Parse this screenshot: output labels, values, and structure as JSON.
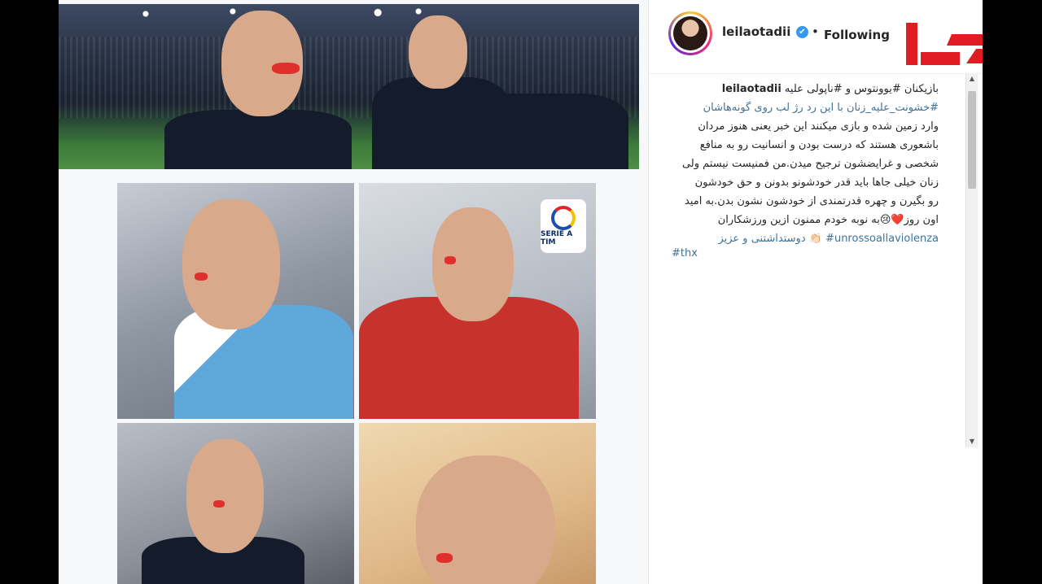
{
  "profile": {
    "username": "leilaotadii",
    "verified_symbol": "✔",
    "separator": "•",
    "follow_status": "Following"
  },
  "caption": {
    "owner": "leilaotadii",
    "text_lines": [
      "بازیکنان #یوونتوس و #ناپولی علیه",
      "#خشونت_علیه_زنان با این رد رژ لب روی گونه‌هاشان",
      "وارد زمین شده و بازی میکنند این خبر یعنی هنوز مردان",
      "باشعوری هستند که درست بودن و انسانیت رو به منافع",
      "شخصی و غرایضشون ترجیح میدن.من فمنیست نیستم ولی",
      "زنان خیلی جاها باید قدر خودشونو بدونن و حق خودشون",
      "رو بگیرن و چهره قدرتمندی از خودشون نشون بدن.به امید",
      "اون روز❤️😢به نوبه خودم ممنون ازین ورزشکاران"
    ],
    "hashtag_line": "دوستداشتنی و عزیز 👏🏻 #unrossoallaviolenza",
    "thx": "#thx"
  },
  "colors": {
    "link": "#3f729b",
    "verified": "#3897f0",
    "logo_red": "#e11b22"
  },
  "icons": {
    "verified": "verified-badge-icon",
    "scroll_up": "scroll-up-arrow-icon",
    "scroll_down": "scroll-down-arrow-icon"
  },
  "scroll": {
    "up": "▲",
    "down": "▼"
  },
  "media": {
    "badge_text": "SERIE A TIM"
  }
}
